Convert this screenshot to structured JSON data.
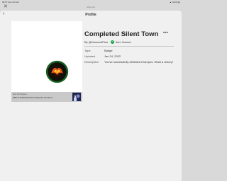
{
  "statusbar": {
    "time": "09:57 Sun 23 Feb",
    "right": "⁠▲ 100% ▮"
  },
  "browser": {
    "close_icon": "close-icon",
    "url": "roblox.com"
  },
  "nav": {
    "title": "Profile",
    "back_icon": "back-arrow-icon"
  },
  "item": {
    "name": "Completed Silent Town",
    "creator": "By @NewcoolFlea",
    "owned_label": "Item Owned",
    "more_icon": "more-icon",
    "details": [
      {
        "key": "Type",
        "value": "Badge"
      },
      {
        "key": "Updated",
        "value": "Jan 24, 2022"
      },
      {
        "key": "Description",
        "value": "You've successfully defeated Krampus. What a victory!"
      }
    ]
  },
  "origin": {
    "label": "Earn this Badge in",
    "game": "[HELLO GUESTS] Someone Plays Elf: The Return"
  },
  "colors": {
    "owned_green": "#1aa64a",
    "card_bg": "#ffffff",
    "page_bg": "#f0f0f0"
  }
}
